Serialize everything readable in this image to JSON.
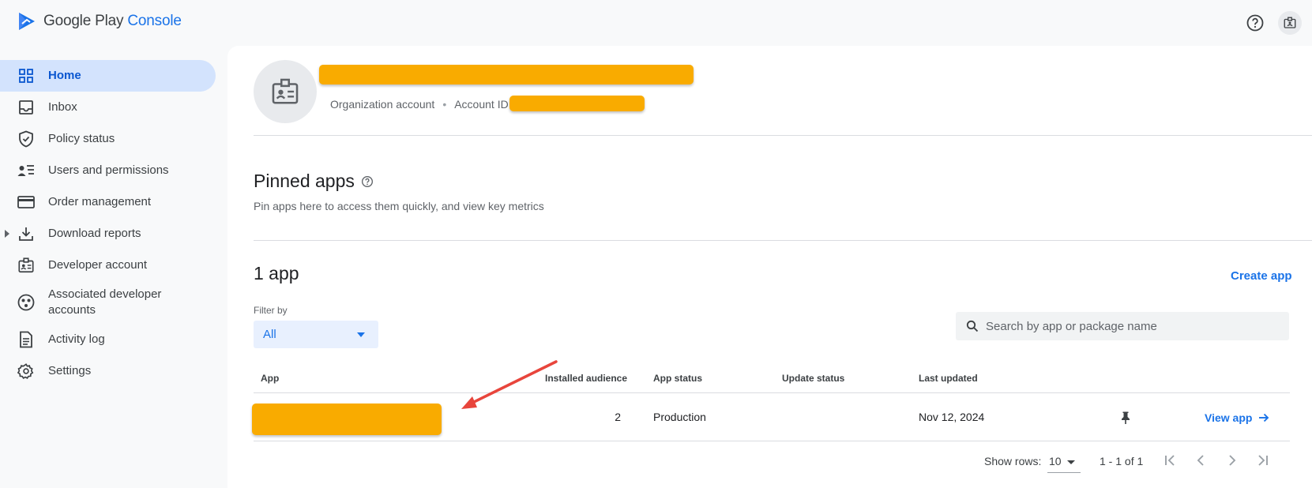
{
  "header": {
    "logo_main": "Google Play",
    "logo_product": "Console",
    "help_icon": "help-circle-icon",
    "account_icon": "developer-badge-icon"
  },
  "sidebar": {
    "items": [
      {
        "label": "Home",
        "icon": "grid-icon",
        "active": true
      },
      {
        "label": "Inbox",
        "icon": "inbox-icon"
      },
      {
        "label": "Policy status",
        "icon": "shield-check-icon"
      },
      {
        "label": "Users and permissions",
        "icon": "users-list-icon"
      },
      {
        "label": "Order management",
        "icon": "credit-card-icon"
      },
      {
        "label": "Download reports",
        "icon": "download-icon",
        "expandable": true
      },
      {
        "label": "Developer account",
        "icon": "id-badge-icon"
      },
      {
        "label": "Associated developer accounts",
        "icon": "linked-accounts-icon"
      },
      {
        "label": "Activity log",
        "icon": "document-icon"
      },
      {
        "label": "Settings",
        "icon": "gear-icon"
      }
    ]
  },
  "account": {
    "type": "Organization account",
    "id_label": "Account ID"
  },
  "pinned": {
    "title": "Pinned apps",
    "subtitle": "Pin apps here to access them quickly, and view key metrics"
  },
  "apps": {
    "count_title": "1 app",
    "create_label": "Create app",
    "filter_label": "Filter by",
    "filter_value": "All",
    "search_placeholder": "Search by app or package name",
    "columns": [
      "App",
      "Installed audience",
      "App status",
      "Update status",
      "Last updated"
    ],
    "rows": [
      {
        "installed_audience": "2",
        "app_status": "Production",
        "update_status": "",
        "last_updated": "Nov 12, 2024",
        "action": "View app"
      }
    ]
  },
  "pagination": {
    "rows_label": "Show rows:",
    "rows_value": "10",
    "range": "1 - 1 of 1"
  },
  "colors": {
    "accent": "#1a73e8",
    "active_nav": "#d3e3fd",
    "redaction": "#f9ab00",
    "annotation_arrow": "#e8453c"
  }
}
